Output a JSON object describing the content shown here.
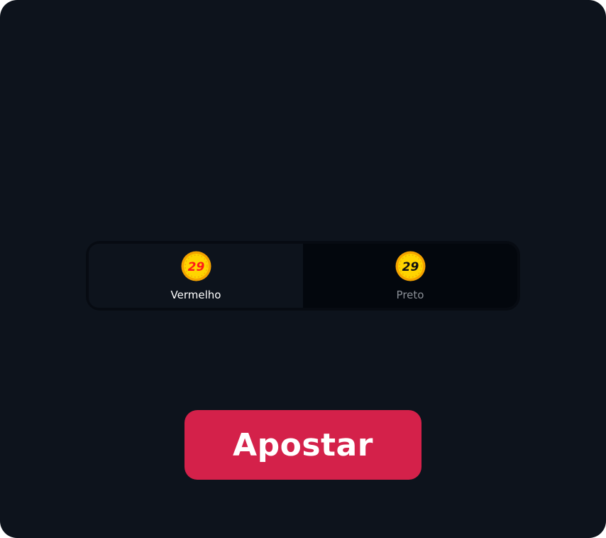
{
  "bet_panel": {
    "options": [
      {
        "label": "Vermelho",
        "coin_number": "29",
        "selected": true,
        "number_color": "#ff1a1a"
      },
      {
        "label": "Preto",
        "coin_number": "29",
        "selected": false,
        "number_color": "#111111"
      }
    ],
    "bet_button_label": "Apostar"
  },
  "colors": {
    "panel_bg": "#0d131c",
    "accent_red": "#d4214a",
    "coin_gold": "#ffd400",
    "coin_rim": "#f5a300"
  }
}
